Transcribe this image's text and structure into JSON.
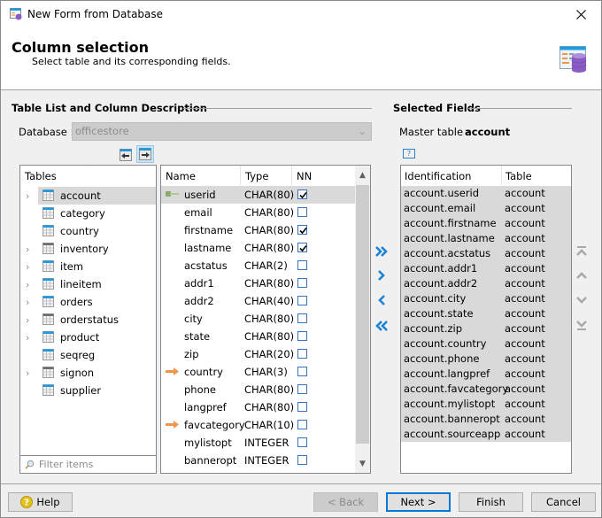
{
  "window": {
    "title": "New Form from Database",
    "close_icon": "close-icon"
  },
  "header": {
    "title": "Column selection",
    "subtitle": "Select table and its corresponding fields.",
    "icon": "form-database-icon"
  },
  "left_section": {
    "title": "Table List and Column Description",
    "database_label": "Database :",
    "database_value": "officestore",
    "toolbar": [
      {
        "icon": "table-import-left-icon",
        "active": false
      },
      {
        "icon": "table-import-right-icon",
        "active": true
      }
    ]
  },
  "tables_panel": {
    "header": "Tables",
    "filter_placeholder": "Filter items",
    "items": [
      {
        "label": "account",
        "expandable": true,
        "selected": true,
        "icon_color": "#1e9be0"
      },
      {
        "label": "category",
        "expandable": false,
        "selected": false,
        "icon_color": "#1e9be0"
      },
      {
        "label": "country",
        "expandable": false,
        "selected": false,
        "icon_color": "#1e9be0"
      },
      {
        "label": "inventory",
        "expandable": true,
        "selected": false,
        "icon_color": "#6e6e6e"
      },
      {
        "label": "item",
        "expandable": true,
        "selected": false,
        "icon_color": "#1e9be0"
      },
      {
        "label": "lineitem",
        "expandable": true,
        "selected": false,
        "icon_color": "#1e9be0"
      },
      {
        "label": "orders",
        "expandable": true,
        "selected": false,
        "icon_color": "#1e9be0"
      },
      {
        "label": "orderstatus",
        "expandable": true,
        "selected": false,
        "icon_color": "#6e6e6e"
      },
      {
        "label": "product",
        "expandable": true,
        "selected": false,
        "icon_color": "#1e9be0"
      },
      {
        "label": "seqreg",
        "expandable": false,
        "selected": false,
        "icon_color": "#1e9be0"
      },
      {
        "label": "signon",
        "expandable": true,
        "selected": false,
        "icon_color": "#6e6e6e"
      },
      {
        "label": "supplier",
        "expandable": false,
        "selected": false,
        "icon_color": "#1e9be0"
      }
    ]
  },
  "columns_panel": {
    "headers": {
      "name": "Name",
      "type": "Type",
      "nn": "NN"
    },
    "rows": [
      {
        "name": "userid",
        "type": "CHAR(80)",
        "nn": true,
        "marker": "primary-key",
        "selected": true
      },
      {
        "name": "email",
        "type": "CHAR(80)",
        "nn": false,
        "marker": "",
        "selected": false
      },
      {
        "name": "firstname",
        "type": "CHAR(80)",
        "nn": true,
        "marker": "",
        "selected": false
      },
      {
        "name": "lastname",
        "type": "CHAR(80)",
        "nn": true,
        "marker": "",
        "selected": false
      },
      {
        "name": "acstatus",
        "type": "CHAR(2)",
        "nn": false,
        "marker": "",
        "selected": false
      },
      {
        "name": "addr1",
        "type": "CHAR(80)",
        "nn": false,
        "marker": "",
        "selected": false
      },
      {
        "name": "addr2",
        "type": "CHAR(40)",
        "nn": false,
        "marker": "",
        "selected": false
      },
      {
        "name": "city",
        "type": "CHAR(80)",
        "nn": false,
        "marker": "",
        "selected": false
      },
      {
        "name": "state",
        "type": "CHAR(80)",
        "nn": false,
        "marker": "",
        "selected": false
      },
      {
        "name": "zip",
        "type": "CHAR(20)",
        "nn": false,
        "marker": "",
        "selected": false
      },
      {
        "name": "country",
        "type": "CHAR(3)",
        "nn": false,
        "marker": "foreign-key",
        "selected": false
      },
      {
        "name": "phone",
        "type": "CHAR(80)",
        "nn": false,
        "marker": "",
        "selected": false
      },
      {
        "name": "langpref",
        "type": "CHAR(80)",
        "nn": false,
        "marker": "",
        "selected": false
      },
      {
        "name": "favcategory",
        "type": "CHAR(10)",
        "nn": false,
        "marker": "foreign-key",
        "selected": false
      },
      {
        "name": "mylistopt",
        "type": "INTEGER",
        "nn": false,
        "marker": "",
        "selected": false
      },
      {
        "name": "banneropt",
        "type": "INTEGER",
        "nn": false,
        "marker": "",
        "selected": false
      }
    ]
  },
  "move_buttons": [
    {
      "name": "add-all-button",
      "icon": "double-chevron-right-icon"
    },
    {
      "name": "add-button",
      "icon": "chevron-right-icon"
    },
    {
      "name": "remove-button",
      "icon": "chevron-left-icon"
    },
    {
      "name": "remove-all-button",
      "icon": "double-chevron-left-icon"
    }
  ],
  "right_section": {
    "title": "Selected Fields",
    "master_label": "Master table :",
    "master_value": "account",
    "help_icon": "help-square-icon",
    "headers": {
      "identification": "Identification",
      "table": "Table"
    },
    "rows": [
      {
        "identification": "account.userid",
        "table": "account"
      },
      {
        "identification": "account.email",
        "table": "account"
      },
      {
        "identification": "account.firstname",
        "table": "account"
      },
      {
        "identification": "account.lastname",
        "table": "account"
      },
      {
        "identification": "account.acstatus",
        "table": "account"
      },
      {
        "identification": "account.addr1",
        "table": "account"
      },
      {
        "identification": "account.addr2",
        "table": "account"
      },
      {
        "identification": "account.city",
        "table": "account"
      },
      {
        "identification": "account.state",
        "table": "account"
      },
      {
        "identification": "account.zip",
        "table": "account"
      },
      {
        "identification": "account.country",
        "table": "account"
      },
      {
        "identification": "account.phone",
        "table": "account"
      },
      {
        "identification": "account.langpref",
        "table": "account"
      },
      {
        "identification": "account.favcategory",
        "table": "account"
      },
      {
        "identification": "account.mylistopt",
        "table": "account"
      },
      {
        "identification": "account.banneropt",
        "table": "account"
      },
      {
        "identification": "account.sourceapp",
        "table": "account"
      }
    ]
  },
  "order_buttons": [
    {
      "name": "move-top-button",
      "icon": "move-top-icon"
    },
    {
      "name": "move-up-button",
      "icon": "move-up-icon"
    },
    {
      "name": "move-down-button",
      "icon": "move-down-icon"
    },
    {
      "name": "move-bottom-button",
      "icon": "move-bottom-icon"
    }
  ],
  "footer": {
    "help": "Help",
    "back": "< Back",
    "next": "Next >",
    "finish": "Finish",
    "cancel": "Cancel"
  },
  "colors": {
    "accent_blue": "#0078d7",
    "arrow_blue": "#1c84d4",
    "key_orange": "#f0954a",
    "selection_gray": "#d9d9d9"
  }
}
